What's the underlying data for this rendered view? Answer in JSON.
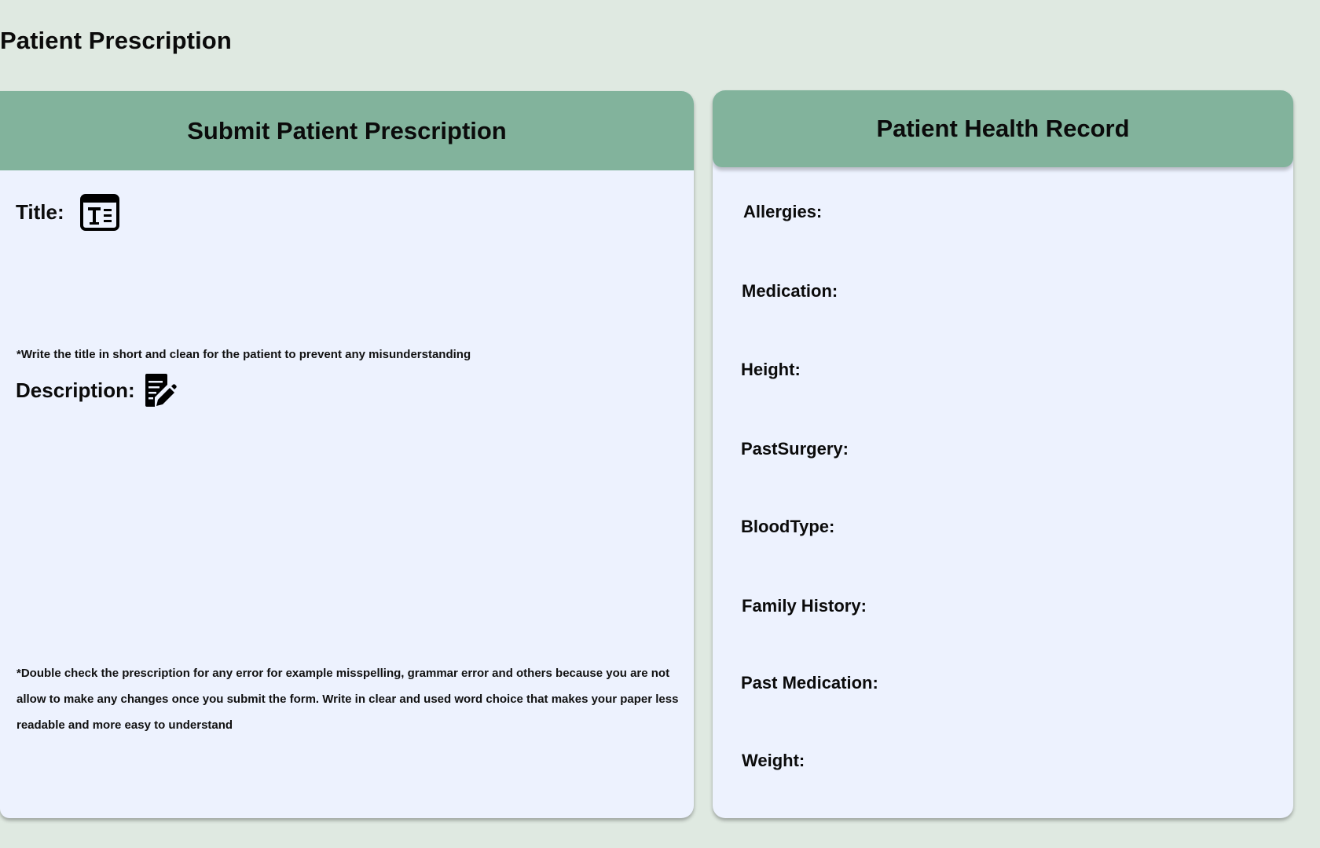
{
  "page": {
    "title": "Patient Prescription"
  },
  "prescription_form": {
    "header": "Submit Patient Prescription",
    "title_label": "Title:",
    "title_icon": "text-title-icon",
    "title_hint": "*Write the title in short and clean for the patient to prevent any misunderstanding",
    "description_label": "Description:",
    "description_icon": "edit-document-icon",
    "description_hint": "*Double check the prescription for any error for example misspelling, grammar error and others because you are not allow to make any changes once you submit the form. Write in clear and used word choice that makes your paper less readable and more easy to understand"
  },
  "health_record": {
    "header": "Patient Health Record",
    "fields": [
      {
        "label": "Allergies:"
      },
      {
        "label": "Medication:"
      },
      {
        "label": "Height:"
      },
      {
        "label": "PastSurgery:"
      },
      {
        "label": "BloodType:"
      },
      {
        "label": "Family History:"
      },
      {
        "label": "Past Medication:"
      },
      {
        "label": "Weight:"
      }
    ]
  },
  "colors": {
    "background": "#dfe9e1",
    "card_header": "#82b39c",
    "card_body": "#edf2fe"
  }
}
